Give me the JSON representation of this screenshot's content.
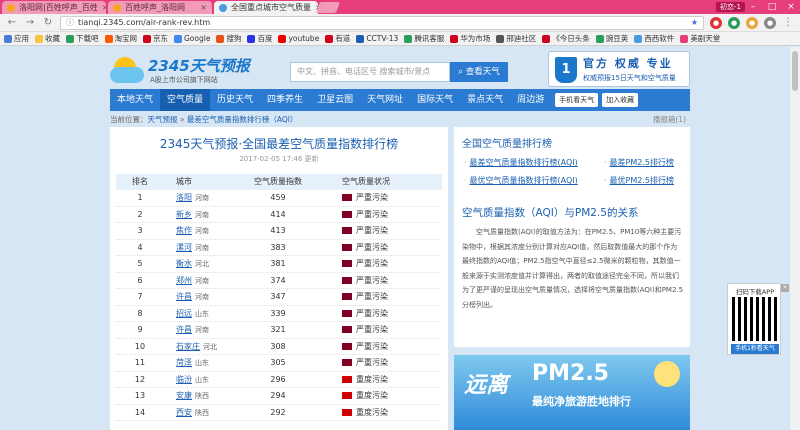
{
  "browser": {
    "tabs": [
      {
        "title": "洛阳网|百姓呼声_百姓",
        "fav": "#f6a623"
      },
      {
        "title": "百姓呼声_洛阳网",
        "fav": "#f6a623"
      },
      {
        "title": "全国重点城市空气质量",
        "fav": "#4a9be3"
      }
    ],
    "tab_close": "×",
    "user_badge": "初恋-1",
    "url": "tianqi.2345.com/air-rank-rev.htm",
    "bookmarks": [
      {
        "label": "应用",
        "color": "#4a7bd8"
      },
      {
        "label": "收藏",
        "color": "#f5c542"
      },
      {
        "label": "下载吧",
        "color": "#2a9d5c"
      },
      {
        "label": "淘宝网",
        "color": "#ff5a00"
      },
      {
        "label": "京东",
        "color": "#d0021b"
      },
      {
        "label": "Google",
        "color": "#4285f4"
      },
      {
        "label": "搜狗",
        "color": "#e8501c"
      },
      {
        "label": "百度",
        "color": "#2932e1"
      },
      {
        "label": "youtube",
        "color": "#e00"
      },
      {
        "label": "有道",
        "color": "#d0021b"
      },
      {
        "label": "CCTV-13",
        "color": "#1a5fb0"
      },
      {
        "label": "腾讯客服",
        "color": "#2a9d5c"
      },
      {
        "label": "华为市场",
        "color": "#d0021b"
      },
      {
        "label": "邢迪社区",
        "color": "#555"
      },
      {
        "label": "《今日头条",
        "color": "#d0021b"
      },
      {
        "label": "豌豆荚",
        "color": "#2a9d5c"
      },
      {
        "label": "西西软件",
        "color": "#4a9be3"
      },
      {
        "label": "美剧天堂",
        "color": "#e63d7d"
      }
    ]
  },
  "header": {
    "logo_name": "2345天气预报",
    "logo_sub": "A股上市公司旗下网站",
    "search_placeholder": "中文、拼音、电话区号 搜索城市/景点",
    "search_button": "查看天气",
    "badge_num": "1",
    "badge_title": "官方 权威 专业",
    "badge_sub": "权威预报15日天气和空气质量"
  },
  "menu": {
    "items": [
      "本地天气",
      "空气质量",
      "历史天气",
      "四季养生",
      "卫星云图",
      "天气网址",
      "国际天气",
      "景点天气",
      "周边游"
    ],
    "active": 1,
    "mobile_btn": "手机看天气",
    "fav_btn": "加入收藏"
  },
  "crumbs": {
    "prefix": "当前位置：",
    "home": "天气预报",
    "sep": " » ",
    "current": "最差空气质量指数排行榜（AQI）",
    "right": "播报箱(1)"
  },
  "main": {
    "title": "2345天气预报·全国最差空气质量指数排行榜",
    "date": "2017-02-05 17:46 更新",
    "columns": [
      "排名",
      "城市",
      "空气质量指数",
      "空气质量状况"
    ],
    "rows": [
      {
        "rank": "1",
        "city": "洛阳",
        "prov": "河南",
        "aqi": "459",
        "status": "严重污染",
        "color": "#7e0023"
      },
      {
        "rank": "2",
        "city": "新乡",
        "prov": "河南",
        "aqi": "414",
        "status": "严重污染",
        "color": "#7e0023"
      },
      {
        "rank": "3",
        "city": "焦作",
        "prov": "河南",
        "aqi": "413",
        "status": "严重污染",
        "color": "#7e0023"
      },
      {
        "rank": "4",
        "city": "漯河",
        "prov": "河南",
        "aqi": "383",
        "status": "严重污染",
        "color": "#7e0023"
      },
      {
        "rank": "5",
        "city": "衡水",
        "prov": "河北",
        "aqi": "381",
        "status": "严重污染",
        "color": "#7e0023"
      },
      {
        "rank": "6",
        "city": "郑州",
        "prov": "河南",
        "aqi": "374",
        "status": "严重污染",
        "color": "#7e0023"
      },
      {
        "rank": "7",
        "city": "许昌",
        "prov": "河南",
        "aqi": "347",
        "status": "严重污染",
        "color": "#7e0023"
      },
      {
        "rank": "8",
        "city": "招远",
        "prov": "山东",
        "aqi": "339",
        "status": "严重污染",
        "color": "#7e0023"
      },
      {
        "rank": "9",
        "city": "许昌",
        "prov": "河南",
        "aqi": "321",
        "status": "严重污染",
        "color": "#7e0023"
      },
      {
        "rank": "10",
        "city": "石家庄",
        "prov": "河北",
        "aqi": "308",
        "status": "严重污染",
        "color": "#7e0023"
      },
      {
        "rank": "11",
        "city": "菏泽",
        "prov": "山东",
        "aqi": "305",
        "status": "严重污染",
        "color": "#7e0023"
      },
      {
        "rank": "12",
        "city": "临汾",
        "prov": "山东",
        "aqi": "296",
        "status": "重度污染",
        "color": "#cc0000"
      },
      {
        "rank": "13",
        "city": "安康",
        "prov": "陕西",
        "aqi": "294",
        "status": "重度污染",
        "color": "#cc0000"
      },
      {
        "rank": "14",
        "city": "西安",
        "prov": "陕西",
        "aqi": "292",
        "status": "重度污染",
        "color": "#cc0000"
      }
    ]
  },
  "side": {
    "title": "全国空气质量排行榜",
    "links": [
      "最差空气质量指数排行榜(AQI)",
      "最差PM2.5排行榜",
      "最优空气质量指数排行榜(AQI)",
      "最优PM2.5排行榜"
    ],
    "sub_title": "空气质量指数（AQI）与PM2.5的关系",
    "paragraph": "空气质量指数(AQI)的取值方法为：在PM2.5、PM10等六种主要污染物中，根据其浓度分别计算对应AQI值，然后取数值最大的那个作为最终指数的AQI值；PM2.5指空气中直径≤2.5微米的颗粒物，其数值一般来源于实测浓度值并计算得出，两者的取值途径完全不同，所以我们为了更严谨的呈现出空气质量情况，选择将空气质量指数(AQI)和PM2.5分榜列出。",
    "ad1": "远离",
    "ad2": "PM2.5",
    "ad3": "最纯净旅游胜地排行"
  },
  "qr": {
    "title": "扫码下载APP",
    "caption": "手机1秒看天气",
    "close": "×"
  }
}
